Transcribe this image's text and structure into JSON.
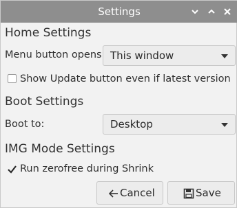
{
  "window": {
    "title": "Settings",
    "controls": [
      {
        "icon": "chevron-down-icon"
      },
      {
        "icon": "chevron-up-icon"
      },
      {
        "icon": "close-icon"
      }
    ]
  },
  "home_settings": {
    "heading": "Home Settings",
    "menu_button_label": "Menu button opens:",
    "menu_button_value": "This window",
    "show_update_label": "Show Update button even if latest version",
    "show_update_checked": false
  },
  "boot_settings": {
    "heading": "Boot Settings",
    "boot_to_label": "Boot to:",
    "boot_to_value": "Desktop"
  },
  "img_mode_settings": {
    "heading": "IMG Mode Settings",
    "zerofree_label": "Run zerofree during Shrink",
    "zerofree_checked": true
  },
  "buttons": {
    "cancel_label": "Cancel",
    "save_label": "Save"
  },
  "colors": {
    "titlebar": "#8e8e8e",
    "window_bg": "#f2f2f2"
  }
}
